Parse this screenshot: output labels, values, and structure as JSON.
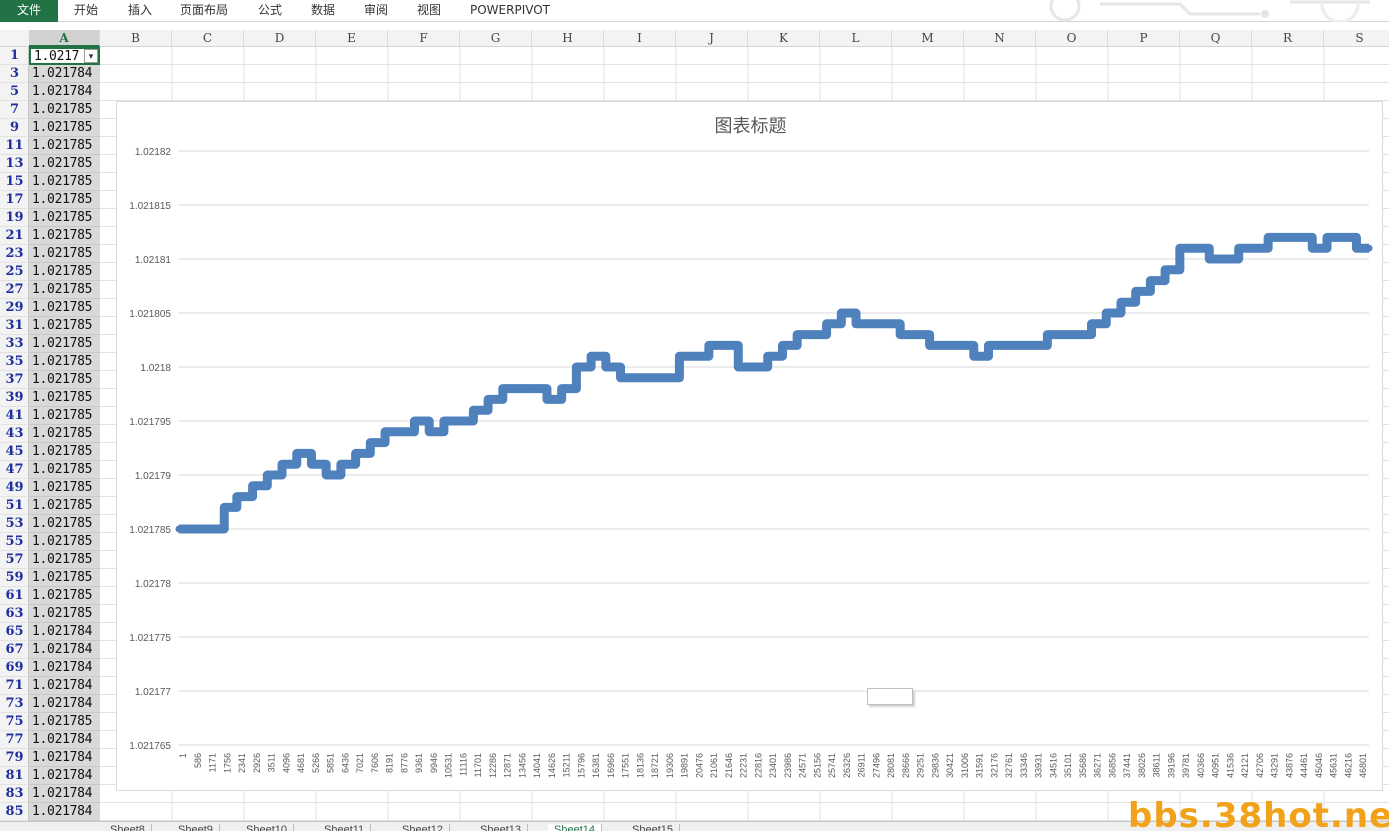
{
  "ribbon": {
    "tabs": [
      "文件",
      "开始",
      "插入",
      "页面布局",
      "公式",
      "数据",
      "审阅",
      "视图",
      "POWERPIVOT"
    ]
  },
  "columns": [
    "A",
    "B",
    "C",
    "D",
    "E",
    "F",
    "G",
    "H",
    "I",
    "J",
    "K",
    "L",
    "M",
    "N",
    "O",
    "P",
    "Q",
    "R",
    "S"
  ],
  "rows": [
    {
      "num": "1",
      "value": "1.0217"
    },
    {
      "num": "3",
      "value": "1.021784"
    },
    {
      "num": "5",
      "value": "1.021784"
    },
    {
      "num": "7",
      "value": "1.021785"
    },
    {
      "num": "9",
      "value": "1.021785"
    },
    {
      "num": "11",
      "value": "1.021785"
    },
    {
      "num": "13",
      "value": "1.021785"
    },
    {
      "num": "15",
      "value": "1.021785"
    },
    {
      "num": "17",
      "value": "1.021785"
    },
    {
      "num": "19",
      "value": "1.021785"
    },
    {
      "num": "21",
      "value": "1.021785"
    },
    {
      "num": "23",
      "value": "1.021785"
    },
    {
      "num": "25",
      "value": "1.021785"
    },
    {
      "num": "27",
      "value": "1.021785"
    },
    {
      "num": "29",
      "value": "1.021785"
    },
    {
      "num": "31",
      "value": "1.021785"
    },
    {
      "num": "33",
      "value": "1.021785"
    },
    {
      "num": "35",
      "value": "1.021785"
    },
    {
      "num": "37",
      "value": "1.021785"
    },
    {
      "num": "39",
      "value": "1.021785"
    },
    {
      "num": "41",
      "value": "1.021785"
    },
    {
      "num": "43",
      "value": "1.021785"
    },
    {
      "num": "45",
      "value": "1.021785"
    },
    {
      "num": "47",
      "value": "1.021785"
    },
    {
      "num": "49",
      "value": "1.021785"
    },
    {
      "num": "51",
      "value": "1.021785"
    },
    {
      "num": "53",
      "value": "1.021785"
    },
    {
      "num": "55",
      "value": "1.021785"
    },
    {
      "num": "57",
      "value": "1.021785"
    },
    {
      "num": "59",
      "value": "1.021785"
    },
    {
      "num": "61",
      "value": "1.021785"
    },
    {
      "num": "63",
      "value": "1.021785"
    },
    {
      "num": "65",
      "value": "1.021784"
    },
    {
      "num": "67",
      "value": "1.021784"
    },
    {
      "num": "69",
      "value": "1.021784"
    },
    {
      "num": "71",
      "value": "1.021784"
    },
    {
      "num": "73",
      "value": "1.021784"
    },
    {
      "num": "75",
      "value": "1.021785"
    },
    {
      "num": "77",
      "value": "1.021784"
    },
    {
      "num": "79",
      "value": "1.021784"
    },
    {
      "num": "81",
      "value": "1.021784"
    },
    {
      "num": "83",
      "value": "1.021784"
    },
    {
      "num": "85",
      "value": "1.021784"
    }
  ],
  "chart_data": {
    "type": "line",
    "title": "图表标题",
    "ylim": [
      1.021765,
      1.02182
    ],
    "yticks": [
      "1.02182",
      "1.021815",
      "1.02181",
      "1.021805",
      "1.0218",
      "1.021795",
      "1.02179",
      "1.021785",
      "1.02178",
      "1.021775",
      "1.02177",
      "1.021765"
    ],
    "xticks": [
      "1",
      "586",
      "1171",
      "1756",
      "2341",
      "2926",
      "3511",
      "4096",
      "4681",
      "5266",
      "5851",
      "6436",
      "7021",
      "7606",
      "8191",
      "8776",
      "9361",
      "9946",
      "10531",
      "11116",
      "11701",
      "12286",
      "12871",
      "13456",
      "14041",
      "14626",
      "15211",
      "15796",
      "16381",
      "16966",
      "17551",
      "18136",
      "18721",
      "19306",
      "19891",
      "20476",
      "21061",
      "21646",
      "22231",
      "22816",
      "23401",
      "23986",
      "24571",
      "25156",
      "25741",
      "26326",
      "26911",
      "27496",
      "28081",
      "28666",
      "29251",
      "29836",
      "30421",
      "31006",
      "31591",
      "32176",
      "32761",
      "33346",
      "33931",
      "34516",
      "35101",
      "35686",
      "36271",
      "36856",
      "37441",
      "38026",
      "38611",
      "39196",
      "39781",
      "40366",
      "40951",
      "41536",
      "42121",
      "42706",
      "43291",
      "43876",
      "44461",
      "45046",
      "45631",
      "46216",
      "46801"
    ],
    "x": [
      1,
      1800,
      2300,
      2926,
      3511,
      4096,
      4681,
      5266,
      5851,
      6436,
      7021,
      7606,
      8191,
      8776,
      9361,
      9946,
      10531,
      11116,
      11701,
      12286,
      12871,
      13456,
      14041,
      14626,
      15211,
      15796,
      16381,
      16966,
      17551,
      18136,
      18721,
      19306,
      19891,
      20476,
      21061,
      21646,
      22231,
      22816,
      23401,
      23986,
      24571,
      25156,
      25741,
      26326,
      26911,
      27496,
      28081,
      28666,
      29251,
      29836,
      30421,
      31006,
      31591,
      32176,
      32761,
      33346,
      33931,
      34516,
      35101,
      35686,
      36271,
      36856,
      37441,
      38026,
      38611,
      39196,
      39781,
      40366,
      40951,
      41536,
      42121,
      42706,
      43291,
      43876,
      44461,
      45046,
      45631,
      46216,
      46801,
      47300
    ],
    "y": [
      1.021785,
      1.021787,
      1.021788,
      1.021789,
      1.02179,
      1.021791,
      1.021792,
      1.021791,
      1.02179,
      1.021791,
      1.021792,
      1.021793,
      1.021794,
      1.021794,
      1.021795,
      1.021794,
      1.021795,
      1.021795,
      1.021796,
      1.021797,
      1.021798,
      1.021798,
      1.021798,
      1.021797,
      1.021798,
      1.0218,
      1.021801,
      1.0218,
      1.021799,
      1.021799,
      1.021799,
      1.021799,
      1.021801,
      1.021801,
      1.021802,
      1.021802,
      1.0218,
      1.0218,
      1.021801,
      1.021802,
      1.021803,
      1.021803,
      1.021804,
      1.021805,
      1.021804,
      1.021804,
      1.021804,
      1.021803,
      1.021803,
      1.021802,
      1.021802,
      1.021802,
      1.021801,
      1.021802,
      1.021802,
      1.021802,
      1.021802,
      1.021803,
      1.021803,
      1.021803,
      1.021804,
      1.021805,
      1.021806,
      1.021807,
      1.021808,
      1.021809,
      1.021811,
      1.021811,
      1.02181,
      1.02181,
      1.021811,
      1.021811,
      1.021812,
      1.021812,
      1.021812,
      1.021811,
      1.021812,
      1.021812,
      1.021811,
      1.021811
    ],
    "color": "#4f81bd",
    "grid": true,
    "legend": false
  },
  "sheet_tabs": [
    "Sheet8",
    "Sheet9",
    "Sheet10",
    "Sheet11",
    "Sheet12",
    "Sheet13",
    "Sheet14",
    "Sheet15"
  ],
  "watermark": "bbs.38hot.net"
}
